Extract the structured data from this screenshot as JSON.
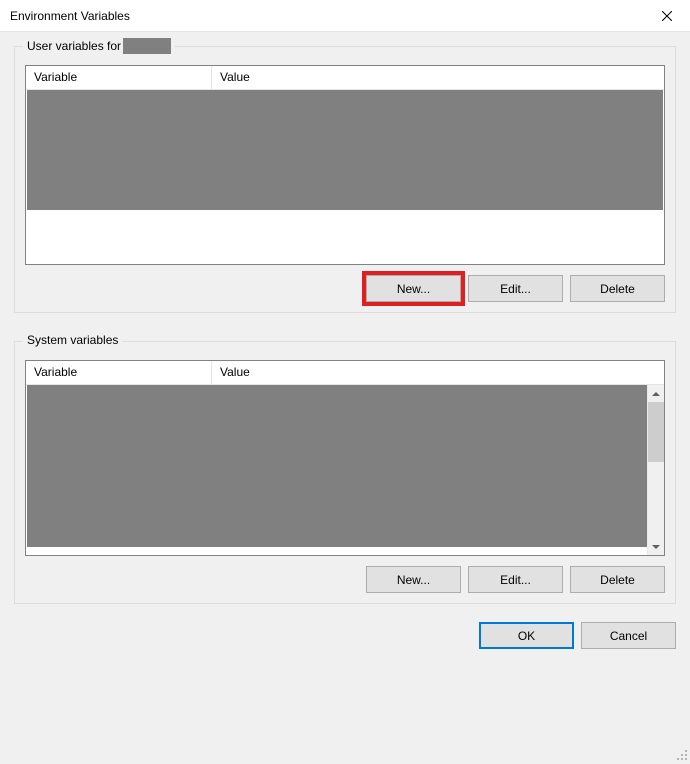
{
  "window": {
    "title": "Environment Variables"
  },
  "user_section": {
    "legend_prefix": "User variables for ",
    "columns": {
      "variable": "Variable",
      "value": "Value"
    },
    "buttons": {
      "new": "New...",
      "edit": "Edit...",
      "delete": "Delete"
    }
  },
  "system_section": {
    "legend": "System variables",
    "columns": {
      "variable": "Variable",
      "value": "Value"
    },
    "buttons": {
      "new": "New...",
      "edit": "Edit...",
      "delete": "Delete"
    }
  },
  "dialog_buttons": {
    "ok": "OK",
    "cancel": "Cancel"
  }
}
